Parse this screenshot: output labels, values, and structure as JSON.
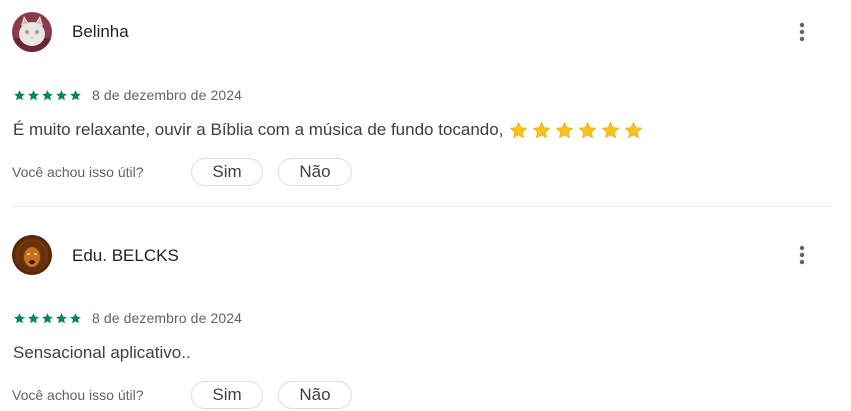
{
  "colors": {
    "star_green": "#01875f",
    "emoji_star_yellow": "#f7c21d",
    "text_primary": "#202124",
    "text_secondary": "#5f6368",
    "border": "#dadce0"
  },
  "reviews": [
    {
      "author": "Belinha",
      "avatar_icon": "cat-avatar",
      "rating": 5,
      "date": "8 de dezembro de 2024",
      "text": "É muito relaxante, ouvir a Bíblia com a música de fundo tocando,",
      "emoji_star_count": 6,
      "helpful_prompt": "Você achou isso útil?",
      "yes_label": "Sim",
      "no_label": "Não"
    },
    {
      "author": "Edu. BELCKS",
      "avatar_icon": "lion-avatar",
      "rating": 5,
      "date": "8 de dezembro de 2024",
      "text": "Sensacional aplicativo..",
      "emoji_star_count": 0,
      "helpful_prompt": "Você achou isso útil?",
      "yes_label": "Sim",
      "no_label": "Não"
    }
  ]
}
